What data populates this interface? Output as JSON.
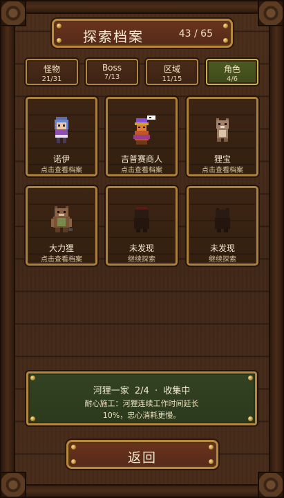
{
  "header": {
    "title": "探索档案",
    "progress": "43 / 65"
  },
  "tabs": [
    {
      "label": "怪物",
      "count": "21/31",
      "active": false
    },
    {
      "label": "Boss",
      "count": "7/13",
      "active": false
    },
    {
      "label": "区域",
      "count": "11/15",
      "active": false
    },
    {
      "label": "角色",
      "count": "4/6",
      "active": true
    }
  ],
  "cards": [
    {
      "name": "诺伊",
      "sub": "点击查看档案",
      "discovered": true,
      "icon": "noi-character-icon"
    },
    {
      "name": "吉普赛商人",
      "sub": "点击查看档案",
      "discovered": true,
      "icon": "gypsy-merchant-icon"
    },
    {
      "name": "狸宝",
      "sub": "点击查看档案",
      "discovered": true,
      "icon": "otter-baby-icon"
    },
    {
      "name": "大力狸",
      "sub": "点击查看档案",
      "discovered": true,
      "icon": "strong-otter-icon"
    },
    {
      "name": "未发现",
      "sub": "继续探索",
      "discovered": false,
      "icon": "locked-otter-silhouette-icon"
    },
    {
      "name": "未发现",
      "sub": "继续探索",
      "discovered": false,
      "icon": "locked-otter-silhouette-icon"
    }
  ],
  "info": {
    "set_name": "河狸一家",
    "set_progress": "2/4",
    "separator": "·",
    "status": "收集中",
    "bonus_line1": "耐心施工：河狸连续工作时间延长",
    "bonus_line2": "10%，忠心消耗更慢。"
  },
  "back_label": "返回",
  "colors": {
    "accent_gold": "#b8883f",
    "panel_green": "#334222",
    "active_tab": "#4d5a22",
    "wood": "#3f2616"
  }
}
